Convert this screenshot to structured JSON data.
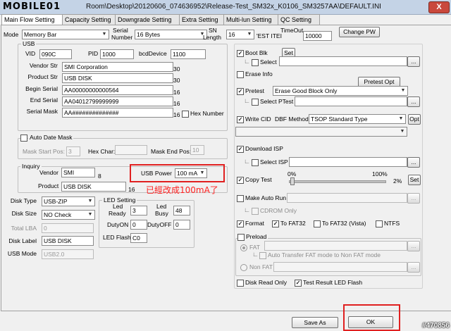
{
  "window": {
    "logo": "MOBILE01",
    "title": "Room\\Desktop\\20120606_074636952\\Release-Test_SM32x_K0106_SM3257AA\\DEFAULT.INI",
    "close": "X"
  },
  "tabs": [
    "Main Flow Setting",
    "Capacity Setting",
    "Downgrade Setting",
    "Extra Setting",
    "Multi-lun Setting",
    "QC Setting"
  ],
  "top": {
    "mode_label": "Mode",
    "mode_value": "Memory Bar",
    "serial_label1": "Serial",
    "serial_label2": "Number",
    "serial_value": "16 Bytes",
    "sn_label1": "SN",
    "sn_label2": "Length",
    "sn_value": "16",
    "est_label": "'EST ITEI",
    "timeout_label": "TimeOut",
    "timeout_value": "10000",
    "change_pw": "Change PW"
  },
  "usb": {
    "group": "USB",
    "vid_label": "VID",
    "vid": "090C",
    "pid_label": "PID",
    "pid": "1000",
    "bcd_label": "bcdDevice",
    "bcd": "1100",
    "vendor_label": "Vendor Str",
    "vendor": "SMI Corporation",
    "vendor_len": "30",
    "product_label": "Product Str",
    "product": "USB DISK",
    "product_len": "30",
    "begin_label": "Begin Serial",
    "begin": "AA00000000000564",
    "begin_len": "16",
    "end_label": "End Serial",
    "end": "AA04012799999999",
    "end_len": "16",
    "mask_label": "Serial Mask",
    "mask": "AA##############",
    "mask_len": "16",
    "hex_label": "Hex Number"
  },
  "date_mask": {
    "label": "Auto Date Mask",
    "start_label": "Mask Start Pos:",
    "start": "3",
    "hex_label": "Hex Char:",
    "end_label": "Mask End Pos:",
    "end": "10"
  },
  "inquiry": {
    "group": "Inquiry",
    "vendor_label": "Vendor",
    "vendor": "SMI",
    "vendor_len": "8",
    "product_label": "Product",
    "product": "USB DISK",
    "product_len": "16",
    "power_label": "USB Power",
    "power": "100 mA",
    "annotation": "已經改成100mA了"
  },
  "disk": {
    "type_label": "Disk Type",
    "type": "USB-ZIP",
    "size_label": "Disk Size",
    "size": "NO Check",
    "lba_label": "Total LBA",
    "lba": "0",
    "dlabel_label": "Disk Label",
    "dlabel": "USB DISK",
    "mode_label": "USB Mode",
    "mode": "USB2.0"
  },
  "led": {
    "group": "LED Setting",
    "ready_label1": "Led",
    "ready_label2": "Ready",
    "ready": "3",
    "busy_label1": "Led",
    "busy_label2": "Busy",
    "busy": "48",
    "on_label": "DutyON",
    "on": "0",
    "off_label": "DutyOFF",
    "off": "0",
    "flash_label": "LED Flash",
    "flash": "C0"
  },
  "right": {
    "boot_blk": "Boot Blk",
    "set": "Set",
    "select": "Select",
    "browse": "...",
    "erase_info": "Erase Info",
    "pretest_opt": "Pretest Opt",
    "pretest": "Pretest",
    "pretest_mode": "Erase Good Block Only",
    "select_ptest": "Select PTest",
    "write_cid": "Write CID",
    "dbf_label": "DBF Method",
    "dbf": "TSOP Standard Type",
    "opt": "Opt",
    "download_isp": "Download ISP",
    "select_isp": "Select ISP",
    "copy_test": "Copy Test",
    "pct0": "0%",
    "pct100": "100%",
    "pct_val": "2%",
    "copy_set": "Set",
    "make_auto_run": "Make Auto Run",
    "cdrom_only": "CDROM Only",
    "format": "Format",
    "fat32": "To FAT32",
    "fat32_vista": "To FAT32 (Vista)",
    "ntfs": "NTFS",
    "preload": "Preload",
    "fat": "FAT",
    "auto_transfer": "Auto Transfer FAT mode to Non FAT mode",
    "non_fat": "Non FAT",
    "disk_read_only": "Disk Read Only",
    "test_result_led": "Test Result LED Flash"
  },
  "bottom": {
    "save_as": "Save As",
    "ok": "OK",
    "watermark": "#470856"
  }
}
